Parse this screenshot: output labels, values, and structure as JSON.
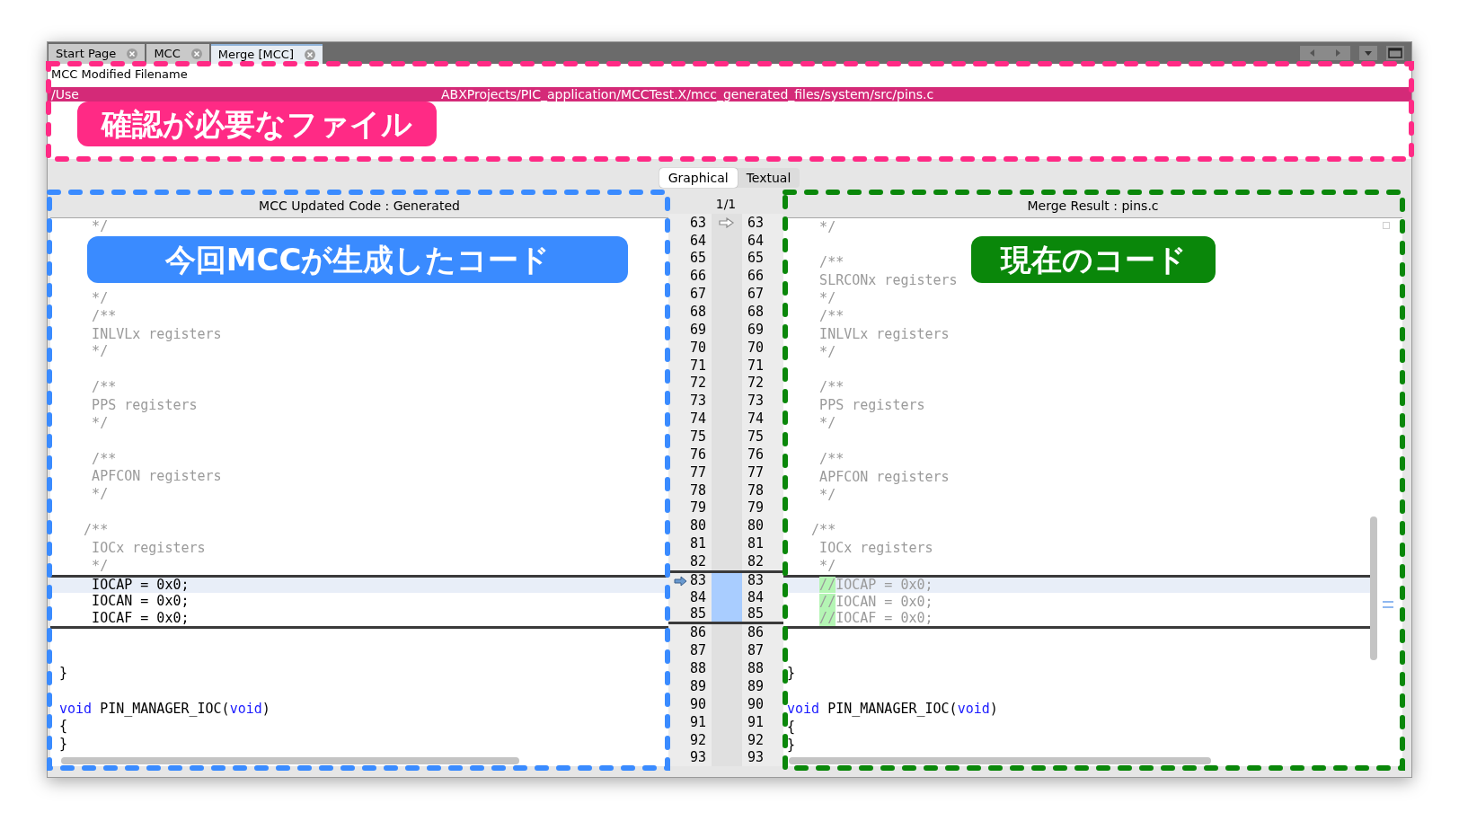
{
  "tabs": [
    {
      "label": "Start Page",
      "selected": false
    },
    {
      "label": "MCC",
      "selected": false
    },
    {
      "label": "Merge [MCC]",
      "selected": true
    }
  ],
  "file_section": {
    "label": "MCC Modified Filename",
    "path_parts": [
      "/Use",
      "ABXProjects/PIC_application/MCCTest.X/mcc_generated_files/system/src/pins.c"
    ]
  },
  "view_toggle": [
    {
      "label": "Graphical",
      "selected": true
    },
    {
      "label": "Textual",
      "selected": false
    }
  ],
  "diff": {
    "left_title": "MCC Updated Code : Generated",
    "counter": "1/1",
    "right_title": "Merge Result : pins.c",
    "rows": [
      {
        "left_num": "63",
        "right_num": "63",
        "changed": false,
        "current": false,
        "left": [
          {
            "kind": "comment",
            "text": "    */"
          }
        ],
        "right": [
          {
            "kind": "comment",
            "text": "    */"
          }
        ]
      },
      {
        "left_num": "64",
        "right_num": "64",
        "changed": false,
        "current": false
      },
      {
        "left_num": "65",
        "right_num": "65",
        "changed": false,
        "current": false,
        "right": [
          {
            "kind": "comment",
            "text": "    /**"
          }
        ]
      },
      {
        "left_num": "66",
        "right_num": "66",
        "changed": false,
        "current": false,
        "right": [
          {
            "kind": "comment",
            "text": "    SLRCONx registers"
          }
        ]
      },
      {
        "left_num": "67",
        "right_num": "67",
        "changed": false,
        "current": false,
        "left": [
          {
            "kind": "comment",
            "text": "    */"
          }
        ],
        "right": [
          {
            "kind": "comment",
            "text": "    */"
          }
        ]
      },
      {
        "left_num": "68",
        "right_num": "68",
        "changed": false,
        "current": false,
        "left": [
          {
            "kind": "comment",
            "text": "    /**"
          }
        ],
        "right": [
          {
            "kind": "comment",
            "text": "    /**"
          }
        ]
      },
      {
        "left_num": "69",
        "right_num": "69",
        "changed": false,
        "current": false,
        "left": [
          {
            "kind": "comment",
            "text": "    INLVLx registers"
          }
        ],
        "right": [
          {
            "kind": "comment",
            "text": "    INLVLx registers"
          }
        ]
      },
      {
        "left_num": "70",
        "right_num": "70",
        "changed": false,
        "current": false,
        "left": [
          {
            "kind": "comment",
            "text": "    */"
          }
        ],
        "right": [
          {
            "kind": "comment",
            "text": "    */"
          }
        ]
      },
      {
        "left_num": "71",
        "right_num": "71",
        "changed": false,
        "current": false
      },
      {
        "left_num": "72",
        "right_num": "72",
        "changed": false,
        "current": false,
        "left": [
          {
            "kind": "comment",
            "text": "    /**"
          }
        ],
        "right": [
          {
            "kind": "comment",
            "text": "    /**"
          }
        ]
      },
      {
        "left_num": "73",
        "right_num": "73",
        "changed": false,
        "current": false,
        "left": [
          {
            "kind": "comment",
            "text": "    PPS registers"
          }
        ],
        "right": [
          {
            "kind": "comment",
            "text": "    PPS registers"
          }
        ]
      },
      {
        "left_num": "74",
        "right_num": "74",
        "changed": false,
        "current": false,
        "left": [
          {
            "kind": "comment",
            "text": "    */"
          }
        ],
        "right": [
          {
            "kind": "comment",
            "text": "    */"
          }
        ]
      },
      {
        "left_num": "75",
        "right_num": "75",
        "changed": false,
        "current": false
      },
      {
        "left_num": "76",
        "right_num": "76",
        "changed": false,
        "current": false,
        "left": [
          {
            "kind": "comment",
            "text": "    /**"
          }
        ],
        "right": [
          {
            "kind": "comment",
            "text": "    /**"
          }
        ]
      },
      {
        "left_num": "77",
        "right_num": "77",
        "changed": false,
        "current": false,
        "left": [
          {
            "kind": "comment",
            "text": "    APFCON registers"
          }
        ],
        "right": [
          {
            "kind": "comment",
            "text": "    APFCON registers"
          }
        ]
      },
      {
        "left_num": "78",
        "right_num": "78",
        "changed": false,
        "current": false,
        "left": [
          {
            "kind": "comment",
            "text": "    */"
          }
        ],
        "right": [
          {
            "kind": "comment",
            "text": "    */"
          }
        ]
      },
      {
        "left_num": "79",
        "right_num": "79",
        "changed": false,
        "current": false
      },
      {
        "left_num": "80",
        "right_num": "80",
        "changed": false,
        "current": false,
        "left": [
          {
            "kind": "comment",
            "text": "   /**"
          }
        ],
        "right": [
          {
            "kind": "comment",
            "text": "   /**"
          }
        ]
      },
      {
        "left_num": "81",
        "right_num": "81",
        "changed": false,
        "current": false,
        "left": [
          {
            "kind": "comment",
            "text": "    IOCx registers"
          }
        ],
        "right": [
          {
            "kind": "comment",
            "text": "    IOCx registers"
          }
        ]
      },
      {
        "left_num": "82",
        "right_num": "82",
        "changed": false,
        "current": false,
        "left": [
          {
            "kind": "comment",
            "text": "    */"
          }
        ],
        "right": [
          {
            "kind": "comment",
            "text": "    */"
          }
        ]
      },
      {
        "left_num": "83",
        "right_num": "83",
        "changed": true,
        "current": true,
        "left": [
          {
            "kind": "code",
            "text": "    IOCAP = 0x0;"
          }
        ],
        "right": [
          {
            "kind": "inserted",
            "indent": true,
            "text": "//"
          },
          {
            "kind": "comment",
            "text": "IOCAP = 0x0;"
          }
        ]
      },
      {
        "left_num": "84",
        "right_num": "84",
        "changed": true,
        "current": false,
        "left": [
          {
            "kind": "code",
            "text": "    IOCAN = 0x0;"
          }
        ],
        "right": [
          {
            "kind": "inserted",
            "indent": true,
            "text": "//"
          },
          {
            "kind": "comment",
            "text": "IOCAN = 0x0;"
          }
        ]
      },
      {
        "left_num": "85",
        "right_num": "85",
        "changed": true,
        "current": false,
        "left": [
          {
            "kind": "code",
            "text": "    IOCAF = 0x0;"
          }
        ],
        "right": [
          {
            "kind": "inserted",
            "indent": true,
            "text": "//"
          },
          {
            "kind": "comment",
            "text": "IOCAF = 0x0;"
          }
        ]
      },
      {
        "left_num": "86",
        "right_num": "86",
        "changed": false,
        "current": false
      },
      {
        "left_num": "87",
        "right_num": "87",
        "changed": false,
        "current": false
      },
      {
        "left_num": "88",
        "right_num": "88",
        "changed": false,
        "current": false,
        "left": [
          {
            "kind": "code",
            "text": "}"
          }
        ],
        "right": [
          {
            "kind": "code",
            "text": "}"
          }
        ]
      },
      {
        "left_num": "89",
        "right_num": "89",
        "changed": false,
        "current": false
      },
      {
        "left_num": "90",
        "right_num": "90",
        "changed": false,
        "current": false,
        "left": [
          {
            "kind": "keyword",
            "text": "void"
          },
          {
            "kind": "code",
            "text": " PIN_MANAGER_IOC("
          },
          {
            "kind": "keyword",
            "text": "void"
          },
          {
            "kind": "code",
            "text": ")"
          }
        ],
        "right": [
          {
            "kind": "keyword",
            "text": "void"
          },
          {
            "kind": "code",
            "text": " PIN_MANAGER_IOC("
          },
          {
            "kind": "keyword",
            "text": "void"
          },
          {
            "kind": "code",
            "text": ")"
          }
        ]
      },
      {
        "left_num": "91",
        "right_num": "91",
        "changed": false,
        "current": false,
        "left": [
          {
            "kind": "code",
            "text": "{"
          }
        ],
        "right": [
          {
            "kind": "code",
            "text": "{"
          }
        ]
      },
      {
        "left_num": "92",
        "right_num": "92",
        "changed": false,
        "current": false,
        "left": [
          {
            "kind": "code",
            "text": "}"
          }
        ],
        "right": [
          {
            "kind": "code",
            "text": "}"
          }
        ]
      },
      {
        "left_num": "93",
        "right_num": "93",
        "changed": false,
        "current": false
      }
    ]
  },
  "annotations": [
    {
      "kind": "file",
      "text": "確認が必要なファイル",
      "color": "#ff2a85"
    },
    {
      "kind": "generated",
      "text": "今回MCCが生成したコード",
      "color": "#3a8bff"
    },
    {
      "kind": "current",
      "text": "現在のコード",
      "color": "#0a870a"
    }
  ]
}
